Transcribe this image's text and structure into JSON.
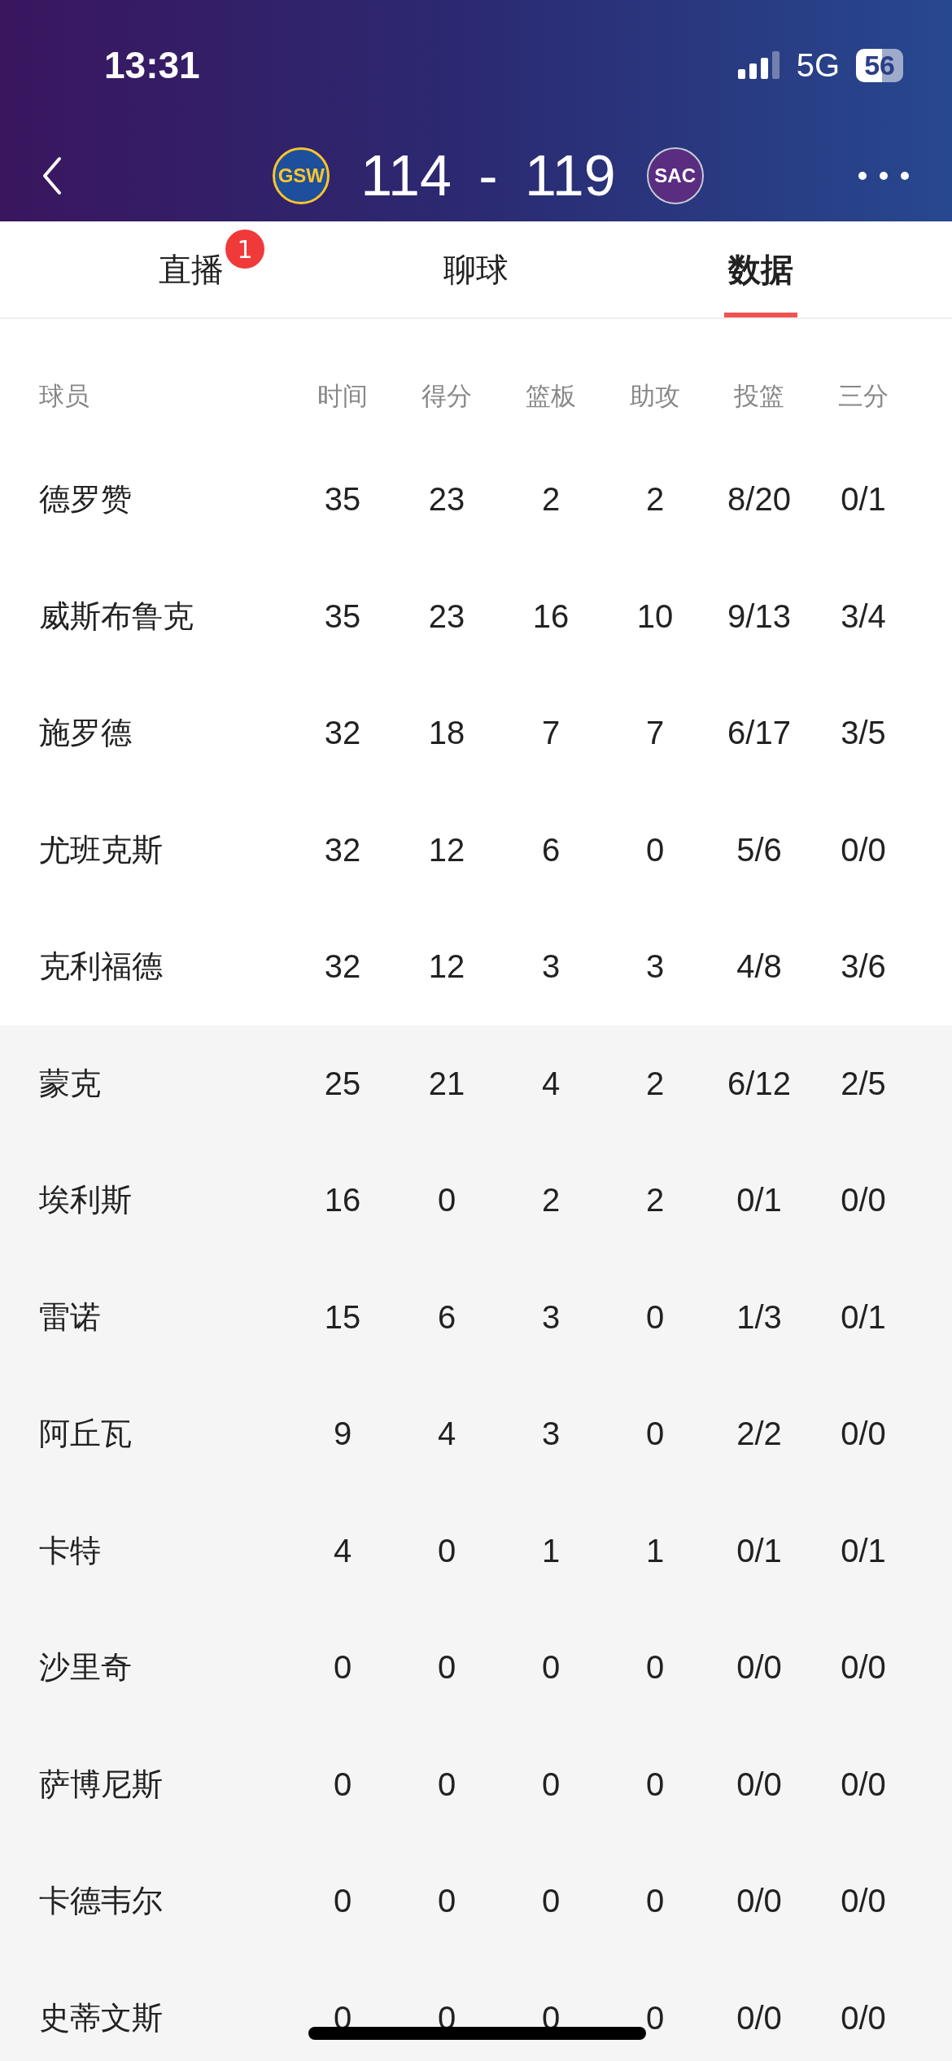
{
  "status_bar": {
    "time": "13:31",
    "network": "5G",
    "battery": "56"
  },
  "header": {
    "home_team": {
      "abbr": "GSW"
    },
    "score": "114 - 119",
    "away_team": {
      "abbr": "SAC"
    }
  },
  "tabs": [
    {
      "label": "直播",
      "selected": false,
      "badge": "1"
    },
    {
      "label": "聊球",
      "selected": false
    },
    {
      "label": "数据",
      "selected": true
    }
  ],
  "table": {
    "columns": [
      "球员",
      "时间",
      "得分",
      "篮板",
      "助攻",
      "投篮",
      "三分"
    ],
    "starters": [
      [
        "德罗赞",
        "35",
        "23",
        "2",
        "2",
        "8/20",
        "0/1"
      ],
      [
        "威斯布鲁克",
        "35",
        "23",
        "16",
        "10",
        "9/13",
        "3/4"
      ],
      [
        "施罗德",
        "32",
        "18",
        "7",
        "7",
        "6/17",
        "3/5"
      ],
      [
        "尤班克斯",
        "32",
        "12",
        "6",
        "0",
        "5/6",
        "0/0"
      ],
      [
        "克利福德",
        "32",
        "12",
        "3",
        "3",
        "4/8",
        "3/6"
      ]
    ],
    "bench": [
      [
        "蒙克",
        "25",
        "21",
        "4",
        "2",
        "6/12",
        "2/5"
      ],
      [
        "埃利斯",
        "16",
        "0",
        "2",
        "2",
        "0/1",
        "0/0"
      ],
      [
        "雷诺",
        "15",
        "6",
        "3",
        "0",
        "1/3",
        "0/1"
      ],
      [
        "阿丘瓦",
        "9",
        "4",
        "3",
        "0",
        "2/2",
        "0/0"
      ],
      [
        "卡特",
        "4",
        "0",
        "1",
        "1",
        "0/1",
        "0/1"
      ],
      [
        "沙里奇",
        "0",
        "0",
        "0",
        "0",
        "0/0",
        "0/0"
      ],
      [
        "萨博尼斯",
        "0",
        "0",
        "0",
        "0",
        "0/0",
        "0/0"
      ],
      [
        "卡德韦尔",
        "0",
        "0",
        "0",
        "0",
        "0/0",
        "0/0"
      ],
      [
        "史蒂文斯",
        "0",
        "0",
        "0",
        "0",
        "0/0",
        "0/0"
      ]
    ]
  }
}
